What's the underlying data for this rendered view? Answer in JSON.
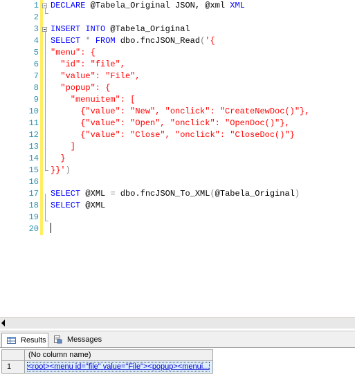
{
  "editor": {
    "line_numbers": [
      "1",
      "2",
      "3",
      "4",
      "5",
      "6",
      "7",
      "8",
      "9",
      "10",
      "11",
      "12",
      "13",
      "14",
      "15",
      "16",
      "17",
      "18",
      "19",
      "20"
    ],
    "line1": {
      "kw1": "DECLARE",
      "rest": " @Tabela_Original JSON, @xml ",
      "kw2": "XML"
    },
    "line3": {
      "kw1": "INSERT INTO",
      "rest": " @Tabela_Original"
    },
    "line4": {
      "kw1": "SELECT",
      "op1": " * ",
      "kw2": "FROM",
      "rest": " dbo.fncJSON_Read",
      "op2": "(",
      "str": "'{"
    },
    "json_lines": [
      "\"menu\": {",
      "  \"id\": \"file\",",
      "  \"value\": \"File\",",
      "  \"popup\": {",
      "    \"menuitem\": [",
      "      {\"value\": \"New\", \"onclick\": \"CreateNewDoc()\"},",
      "      {\"value\": \"Open\", \"onclick\": \"OpenDoc()\"},",
      "      {\"value\": \"Close\", \"onclick\": \"CloseDoc()\"}",
      "    ]",
      "  }",
      "}}'"
    ],
    "line15_close": ")",
    "line17": {
      "kw1": "SELECT",
      "rest1": " @XML ",
      "op1": "=",
      "rest2": " dbo.fncJSON_To_XML",
      "op2": "(",
      "arg": "@Tabela_Original",
      "op3": ")"
    },
    "line18": {
      "kw1": "SELECT",
      "rest": " @XML"
    }
  },
  "tabs": {
    "results": "Results",
    "messages": "Messages"
  },
  "results": {
    "column_header": "(No column name)",
    "row_number": "1",
    "cell_value": "<root><menu id=\"file\" value=\"File\"><popup><menui..."
  }
}
